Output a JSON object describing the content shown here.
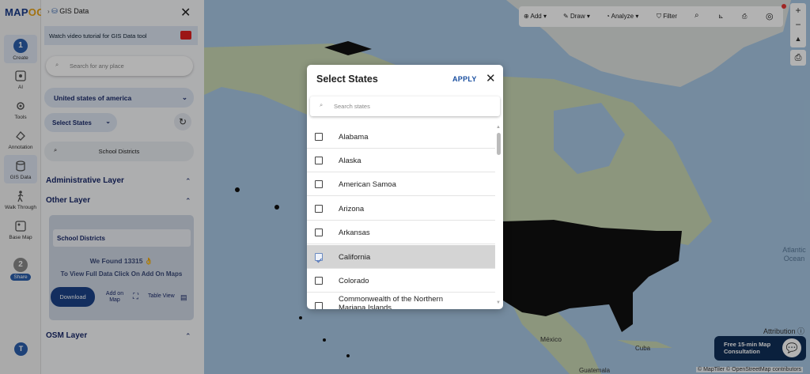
{
  "app": {
    "logo_main": "MAP",
    "logo_accent": "OG",
    "panel_title": "GIS Data"
  },
  "rail": {
    "items": [
      {
        "label": "Create",
        "step": "1"
      },
      {
        "label": "AI"
      },
      {
        "label": "Tools"
      },
      {
        "label": "Annotation"
      },
      {
        "label": "GIS Data"
      },
      {
        "label": "Walk Through"
      },
      {
        "label": "Base Map"
      },
      {
        "label": "Share",
        "step": "2"
      }
    ],
    "user_initial": "T"
  },
  "panel": {
    "tutorial": "Watch video tutorial for GIS Data tool",
    "search_placeholder": "Search for any place",
    "country": "United states of america",
    "states_button": "Select States",
    "dataset": "School Districts",
    "sections": {
      "admin": "Administrative Layer",
      "other": "Other Layer",
      "osm": "OSM Layer"
    },
    "card": {
      "title": "School Districts",
      "found": "We Found  13315 👌",
      "instruction": "To View Full Data Click On Add On Maps",
      "download": "Download",
      "add_on_map": "Add on Map",
      "table_view": "Table View"
    }
  },
  "toolbar": {
    "add": "Add",
    "draw": "Draw",
    "analyze": "Analyze",
    "filter": "Filter"
  },
  "zoom": {
    "in": "+",
    "out": "−"
  },
  "modal": {
    "title": "Select States",
    "apply": "APPLY",
    "search_placeholder": "Search states",
    "states": [
      {
        "name": "Alabama",
        "checked": false
      },
      {
        "name": "Alaska",
        "checked": false
      },
      {
        "name": "American Samoa",
        "checked": false
      },
      {
        "name": "Arizona",
        "checked": false
      },
      {
        "name": "Arkansas",
        "checked": false
      },
      {
        "name": "California",
        "checked": true
      },
      {
        "name": "Colorado",
        "checked": false
      },
      {
        "name": "Commonwealth of the Northern Mariana Islands",
        "checked": false
      }
    ]
  },
  "map": {
    "labels": {
      "atlantic": "Atlantic Ocean",
      "mexico": "México",
      "cuba": "Cuba",
      "guatemala": "Guatemala"
    },
    "attribution": "Attribution",
    "copyright": "© MapTiler © OpenStreetMap contributors"
  },
  "consult": {
    "line1": "Free 15-min Map",
    "line2": "Consultation"
  },
  "colors": {
    "accent": "#1c4388",
    "land": "#c9d7b4",
    "water": "#a8c8e4"
  }
}
